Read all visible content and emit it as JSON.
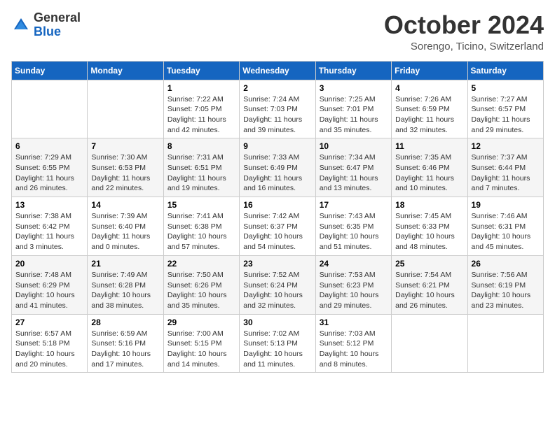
{
  "header": {
    "logo_general": "General",
    "logo_blue": "Blue",
    "month_title": "October 2024",
    "subtitle": "Sorengo, Ticino, Switzerland"
  },
  "weekdays": [
    "Sunday",
    "Monday",
    "Tuesday",
    "Wednesday",
    "Thursday",
    "Friday",
    "Saturday"
  ],
  "weeks": [
    [
      {
        "day": "",
        "content": ""
      },
      {
        "day": "",
        "content": ""
      },
      {
        "day": "1",
        "content": "Sunrise: 7:22 AM\nSunset: 7:05 PM\nDaylight: 11 hours and 42 minutes."
      },
      {
        "day": "2",
        "content": "Sunrise: 7:24 AM\nSunset: 7:03 PM\nDaylight: 11 hours and 39 minutes."
      },
      {
        "day": "3",
        "content": "Sunrise: 7:25 AM\nSunset: 7:01 PM\nDaylight: 11 hours and 35 minutes."
      },
      {
        "day": "4",
        "content": "Sunrise: 7:26 AM\nSunset: 6:59 PM\nDaylight: 11 hours and 32 minutes."
      },
      {
        "day": "5",
        "content": "Sunrise: 7:27 AM\nSunset: 6:57 PM\nDaylight: 11 hours and 29 minutes."
      }
    ],
    [
      {
        "day": "6",
        "content": "Sunrise: 7:29 AM\nSunset: 6:55 PM\nDaylight: 11 hours and 26 minutes."
      },
      {
        "day": "7",
        "content": "Sunrise: 7:30 AM\nSunset: 6:53 PM\nDaylight: 11 hours and 22 minutes."
      },
      {
        "day": "8",
        "content": "Sunrise: 7:31 AM\nSunset: 6:51 PM\nDaylight: 11 hours and 19 minutes."
      },
      {
        "day": "9",
        "content": "Sunrise: 7:33 AM\nSunset: 6:49 PM\nDaylight: 11 hours and 16 minutes."
      },
      {
        "day": "10",
        "content": "Sunrise: 7:34 AM\nSunset: 6:47 PM\nDaylight: 11 hours and 13 minutes."
      },
      {
        "day": "11",
        "content": "Sunrise: 7:35 AM\nSunset: 6:46 PM\nDaylight: 11 hours and 10 minutes."
      },
      {
        "day": "12",
        "content": "Sunrise: 7:37 AM\nSunset: 6:44 PM\nDaylight: 11 hours and 7 minutes."
      }
    ],
    [
      {
        "day": "13",
        "content": "Sunrise: 7:38 AM\nSunset: 6:42 PM\nDaylight: 11 hours and 3 minutes."
      },
      {
        "day": "14",
        "content": "Sunrise: 7:39 AM\nSunset: 6:40 PM\nDaylight: 11 hours and 0 minutes."
      },
      {
        "day": "15",
        "content": "Sunrise: 7:41 AM\nSunset: 6:38 PM\nDaylight: 10 hours and 57 minutes."
      },
      {
        "day": "16",
        "content": "Sunrise: 7:42 AM\nSunset: 6:37 PM\nDaylight: 10 hours and 54 minutes."
      },
      {
        "day": "17",
        "content": "Sunrise: 7:43 AM\nSunset: 6:35 PM\nDaylight: 10 hours and 51 minutes."
      },
      {
        "day": "18",
        "content": "Sunrise: 7:45 AM\nSunset: 6:33 PM\nDaylight: 10 hours and 48 minutes."
      },
      {
        "day": "19",
        "content": "Sunrise: 7:46 AM\nSunset: 6:31 PM\nDaylight: 10 hours and 45 minutes."
      }
    ],
    [
      {
        "day": "20",
        "content": "Sunrise: 7:48 AM\nSunset: 6:29 PM\nDaylight: 10 hours and 41 minutes."
      },
      {
        "day": "21",
        "content": "Sunrise: 7:49 AM\nSunset: 6:28 PM\nDaylight: 10 hours and 38 minutes."
      },
      {
        "day": "22",
        "content": "Sunrise: 7:50 AM\nSunset: 6:26 PM\nDaylight: 10 hours and 35 minutes."
      },
      {
        "day": "23",
        "content": "Sunrise: 7:52 AM\nSunset: 6:24 PM\nDaylight: 10 hours and 32 minutes."
      },
      {
        "day": "24",
        "content": "Sunrise: 7:53 AM\nSunset: 6:23 PM\nDaylight: 10 hours and 29 minutes."
      },
      {
        "day": "25",
        "content": "Sunrise: 7:54 AM\nSunset: 6:21 PM\nDaylight: 10 hours and 26 minutes."
      },
      {
        "day": "26",
        "content": "Sunrise: 7:56 AM\nSunset: 6:19 PM\nDaylight: 10 hours and 23 minutes."
      }
    ],
    [
      {
        "day": "27",
        "content": "Sunrise: 6:57 AM\nSunset: 5:18 PM\nDaylight: 10 hours and 20 minutes."
      },
      {
        "day": "28",
        "content": "Sunrise: 6:59 AM\nSunset: 5:16 PM\nDaylight: 10 hours and 17 minutes."
      },
      {
        "day": "29",
        "content": "Sunrise: 7:00 AM\nSunset: 5:15 PM\nDaylight: 10 hours and 14 minutes."
      },
      {
        "day": "30",
        "content": "Sunrise: 7:02 AM\nSunset: 5:13 PM\nDaylight: 10 hours and 11 minutes."
      },
      {
        "day": "31",
        "content": "Sunrise: 7:03 AM\nSunset: 5:12 PM\nDaylight: 10 hours and 8 minutes."
      },
      {
        "day": "",
        "content": ""
      },
      {
        "day": "",
        "content": ""
      }
    ]
  ]
}
